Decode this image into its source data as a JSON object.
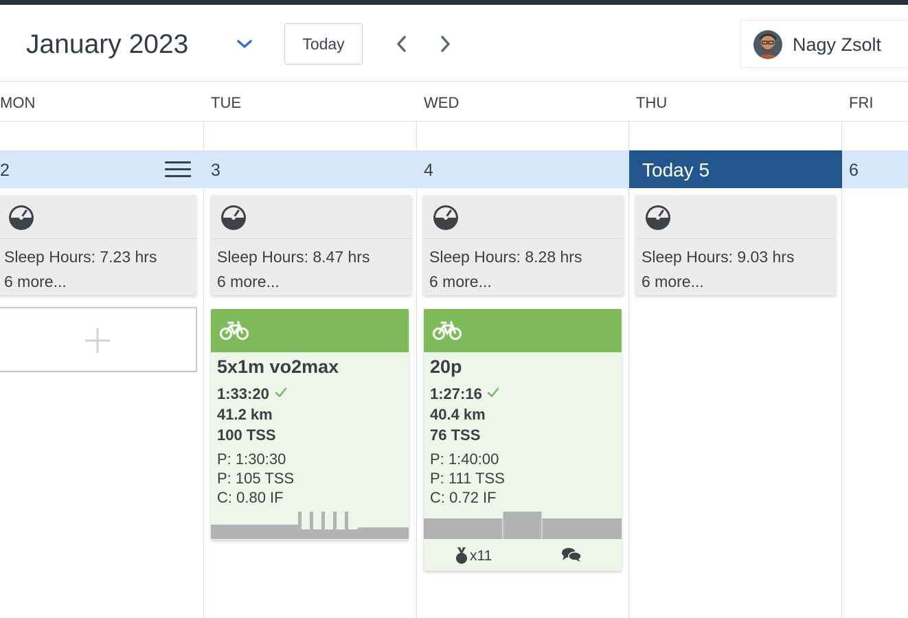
{
  "header": {
    "month_title": "January 2023",
    "today_button": "Today",
    "user_name": "Nagy Zsolt"
  },
  "days_of_week": [
    "MON",
    "TUE",
    "WED",
    "THU",
    "FRI"
  ],
  "dates": {
    "mon": "2",
    "tue": "3",
    "wed": "4",
    "thu": "Today 5",
    "fri": "6"
  },
  "metrics": [
    {
      "sleep": "Sleep Hours: 7.23 hrs",
      "more": "6 more..."
    },
    {
      "sleep": "Sleep Hours: 8.47 hrs",
      "more": "6 more..."
    },
    {
      "sleep": "Sleep Hours: 8.28 hrs",
      "more": "6 more..."
    },
    {
      "sleep": "Sleep Hours: 9.03 hrs",
      "more": "6 more..."
    }
  ],
  "workouts": [
    {
      "title": "5x1m vo2max",
      "duration": "1:33:20",
      "distance": "41.2 km",
      "tss": "100 TSS",
      "planned_duration": "P: 1:30:30",
      "planned_tss": "P: 105 TSS",
      "intensity": "C: 0.80 IF"
    },
    {
      "title": "20p",
      "duration": "1:27:16",
      "distance": "40.4 km",
      "tss": "76 TSS",
      "planned_duration": "P: 1:40:00",
      "planned_tss": "P: 111 TSS",
      "intensity": "C: 0.72 IF",
      "medals": "x11"
    }
  ],
  "colors": {
    "accent": "#24568e",
    "date_row": "#d7e8fb",
    "workout_header": "#7fbb5b",
    "workout_body": "#eef6ea",
    "check": "#6cbf5a"
  }
}
